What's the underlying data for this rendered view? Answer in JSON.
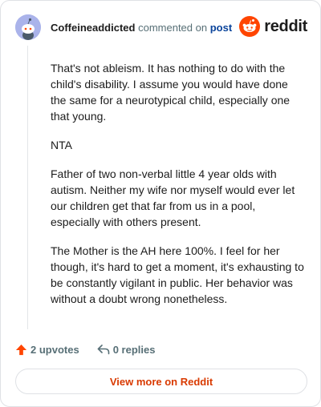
{
  "header": {
    "username": "Coffeineaddicted",
    "action_text": "commented on",
    "post_link": "post",
    "brand_name": "reddit",
    "brand_color": "#ff4500",
    "avatar_color": "#aab3ea"
  },
  "comment": {
    "paragraphs": [
      "That's not ableism. It has nothing to do with the child's disability. I assume you would have done the same for a neurotypical child, especially one that young.",
      "NTA",
      "Father of two non-verbal little 4 year olds with autism. Neither my wife nor myself would ever let our children get that far from us in a pool, especially with others present.",
      "The Mother is the AH here 100%. I feel for her though, it's hard to get a moment, it's exhausting to be constantly vigilant in public. Her behavior was without a doubt wrong nonetheless."
    ]
  },
  "actions": {
    "upvotes": "2 upvotes",
    "replies": "0 replies",
    "upvote_icon": "upvote-arrow-icon",
    "reply_icon": "reply-arrow-icon"
  },
  "footer": {
    "view_more_label": "View more on Reddit",
    "link_color": "#d93a00"
  }
}
